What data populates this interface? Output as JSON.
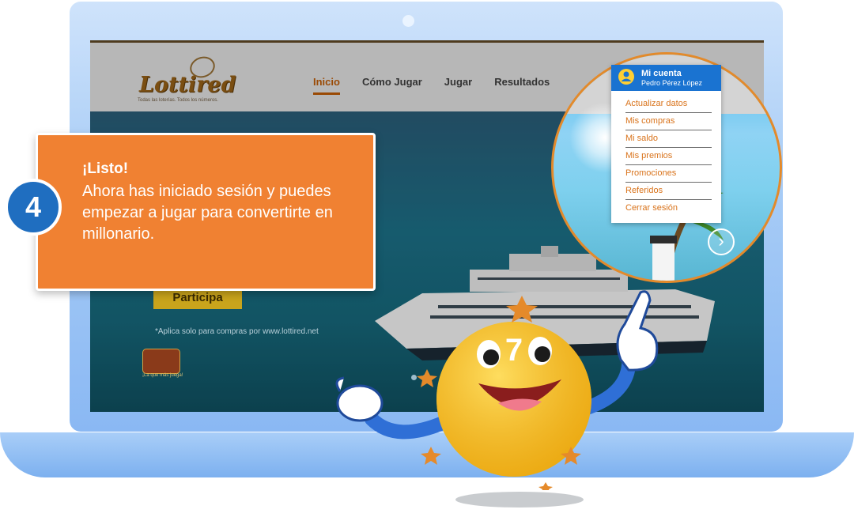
{
  "site": {
    "logo": "Lottired",
    "logo_tagline": "Todas las loterías. Todos los números.",
    "nav": [
      {
        "label": "Inicio",
        "active": true
      },
      {
        "label": "Cómo Jugar",
        "active": false
      },
      {
        "label": "Jugar",
        "active": false
      },
      {
        "label": "Resultados",
        "active": false
      }
    ],
    "hero": {
      "button_label": "Participa",
      "disclaimer": "*Aplica solo para compras por www.lottired.net",
      "mini_logo_text": "¡La que más juega!"
    }
  },
  "account_menu": {
    "title": "Mi cuenta",
    "user": "Pedro Pérez López",
    "items": [
      "Actualizar datos",
      "Mis compras",
      "Mi saldo",
      "Mis premios",
      "Promociones",
      "Referidos",
      "Cerrar sesión"
    ]
  },
  "callout": {
    "step": "4",
    "title": "¡Listo!",
    "body": "Ahora has iniciado sesión y puedes empezar a jugar para convertirte en millonario."
  },
  "mascot": {
    "number": "7"
  },
  "colors": {
    "callout_bg": "#f08132",
    "badge_bg": "#1f6ec0",
    "menu_header": "#1a73d1",
    "menu_link": "#d9731b",
    "laptop": "#8ab8f3"
  },
  "icons": [
    "user-avatar-icon",
    "chevron-right-icon",
    "star-icon"
  ]
}
